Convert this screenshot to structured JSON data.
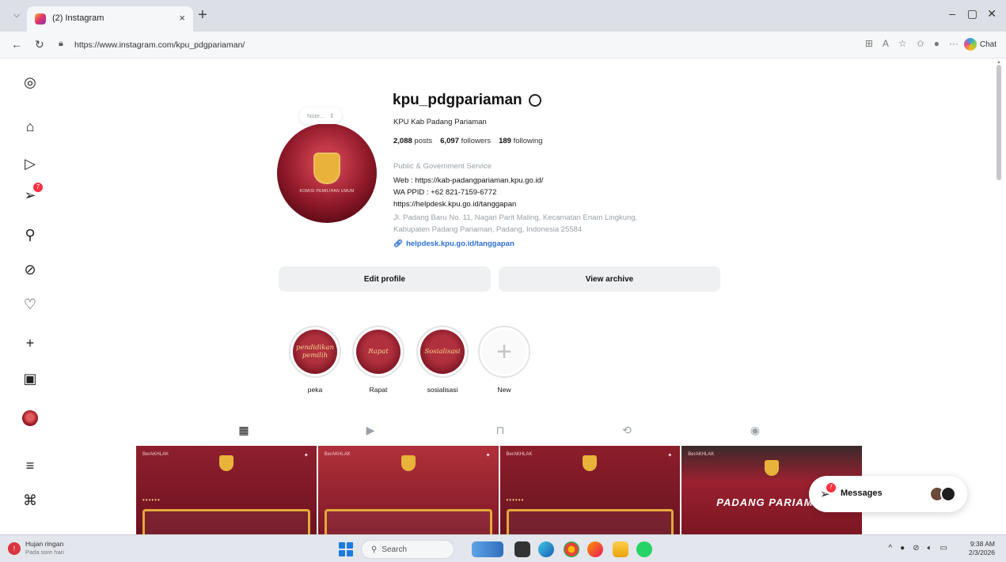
{
  "browser": {
    "tab_title": "(2) Instagram",
    "tab_close": "×",
    "new_tab": "+",
    "url": "https://www.instagram.com/kpu_pdgpariaman/",
    "chat_label": "Chat"
  },
  "profile": {
    "note": "Note...",
    "username": "kpu_pdgpariaman",
    "full_name": "KPU Kab Padang Pariaman",
    "posts_count": "2,088",
    "posts_label": "posts",
    "followers_count": "6,097",
    "followers_label": "followers",
    "following_count": "189",
    "following_label": "following",
    "category": "Public & Government Service",
    "bio_lines": [
      "Web : https://kab-padangpariaman.kpu.go.id/",
      "WA PPID : +62 821-7159-6772",
      "https://helpdesk.kpu.go.id/tanggapan"
    ],
    "address_lines": [
      "Jl. Padang Baru No. 11, Nagari Parit Maling, Kecamatan Enam Lingkung,",
      "Kabupaten Padang Pariaman, Padang, Indonesia 25584"
    ],
    "link": "helpdesk.kpu.go.id/tanggapan",
    "edit_profile": "Edit profile",
    "view_archive": "View archive"
  },
  "highlights": [
    {
      "label": "peka",
      "cover_text": "pendidikan pemilih"
    },
    {
      "label": "Rapat",
      "cover_text": "Rapat"
    },
    {
      "label": "sosialisasi",
      "cover_text": "Sosialisasi"
    },
    {
      "label": "New",
      "cover_text": "+"
    }
  ],
  "posts": [
    {
      "tag": "BerAKHLAK",
      "label": ""
    },
    {
      "tag": "BerAKHLAK",
      "label": ""
    },
    {
      "tag": "BerAKHLAK",
      "label": ""
    },
    {
      "tag": "BerAKHLAK",
      "label": "PADANG PARIAMAN"
    }
  ],
  "messages": {
    "label": "Messages",
    "badge": "7"
  },
  "sidebar": {
    "notification_badge": "7"
  },
  "taskbar": {
    "weather_title": "Hujan ringan",
    "weather_sub": "Pada sore hari",
    "search_placeholder": "Search",
    "time": "9:38 AM",
    "date": "2/3/2026"
  },
  "colors": {
    "brand_maroon": "#8d1828",
    "link_blue": "#2b6fd6",
    "badge_red": "#ff3040"
  }
}
